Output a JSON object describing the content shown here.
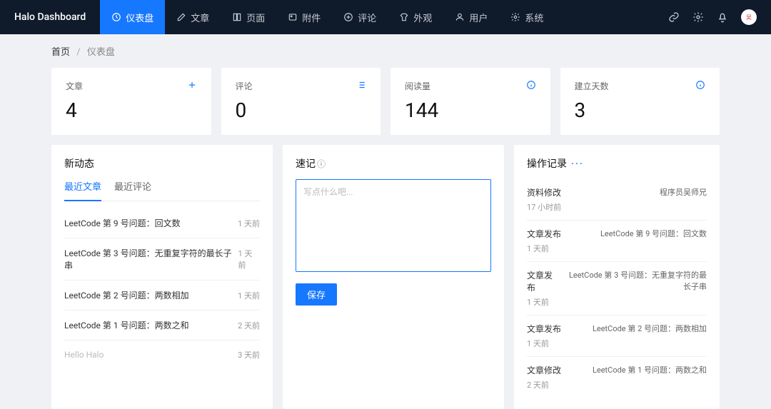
{
  "brand": "Halo Dashboard",
  "nav": [
    {
      "label": "仪表盘"
    },
    {
      "label": "文章"
    },
    {
      "label": "页面"
    },
    {
      "label": "附件"
    },
    {
      "label": "评论"
    },
    {
      "label": "外观"
    },
    {
      "label": "用户"
    },
    {
      "label": "系统"
    }
  ],
  "breadcrumb": {
    "home": "首页",
    "current": "仪表盘"
  },
  "stats": [
    {
      "label": "文章",
      "value": "4",
      "icon": "plus"
    },
    {
      "label": "评论",
      "value": "0",
      "icon": "list"
    },
    {
      "label": "阅读量",
      "value": "144",
      "icon": "info"
    },
    {
      "label": "建立天数",
      "value": "3",
      "icon": "info"
    }
  ],
  "activity": {
    "title": "新动态",
    "tabs": [
      {
        "label": "最近文章"
      },
      {
        "label": "最近评论"
      }
    ],
    "posts": [
      {
        "title": "LeetCode 第 9 号问题：回文数",
        "time": "1 天前"
      },
      {
        "title": "LeetCode 第 3 号问题：无重复字符的最长子串",
        "time": "1 天前"
      },
      {
        "title": "LeetCode 第 2 号问题：两数相加",
        "time": "1 天前"
      },
      {
        "title": "LeetCode 第 1 号问题：两数之和",
        "time": "2 天前"
      },
      {
        "title": "Hello Halo",
        "time": "3 天前",
        "muted": true
      }
    ]
  },
  "quicknote": {
    "title": "速记",
    "placeholder": "写点什么吧...",
    "save": "保存"
  },
  "logs": {
    "title": "操作记录",
    "items": [
      {
        "type": "资料修改",
        "detail": "程序员吴师兄",
        "time": "17 小时前"
      },
      {
        "type": "文章发布",
        "detail": "LeetCode 第 9 号问题：回文数",
        "time": "1 天前"
      },
      {
        "type": "文章发布",
        "detail": "LeetCode 第 3 号问题：无重复字符的最长子串",
        "time": "1 天前"
      },
      {
        "type": "文章发布",
        "detail": "LeetCode 第 2 号问题：两数相加",
        "time": "1 天前"
      },
      {
        "type": "文章修改",
        "detail": "LeetCode 第 1 号问题：两数之和",
        "time": "2 天前"
      }
    ]
  }
}
